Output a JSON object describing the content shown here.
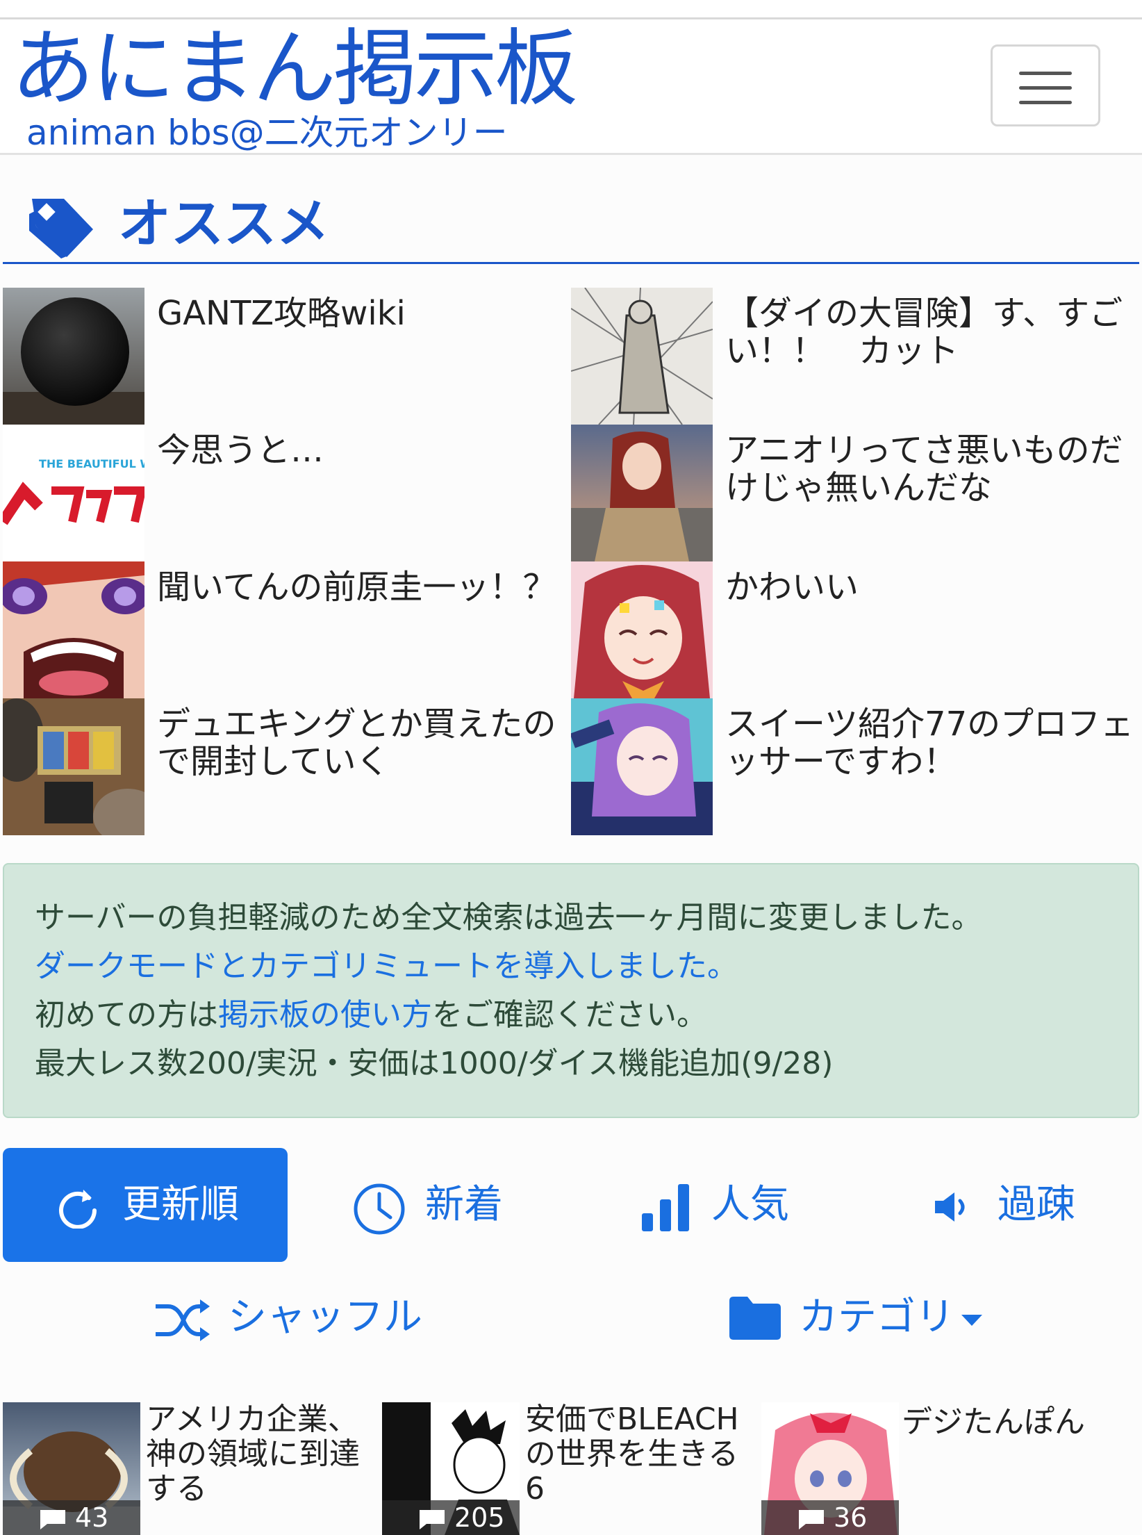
{
  "header": {
    "logo_main": "あにまん掲示板",
    "logo_sub": "animan bbs@二次元オンリー",
    "menu_icon": "hamburger-menu-icon"
  },
  "recommend": {
    "title": "オススメ",
    "icon": "tag-icon",
    "items": [
      {
        "title": "GANTZ攻略wiki"
      },
      {
        "title": "【ダイの大冒険】す、すごい！！　カット"
      },
      {
        "title": "今思うと…",
        "thumb_text": "THE BEAUTIFUL WORLD ヘタリア"
      },
      {
        "title": "アニオリってさ悪いものだけじゃ無いんだな"
      },
      {
        "title": "聞いてんの前原圭一ッ！？"
      },
      {
        "title": "かわいい"
      },
      {
        "title": "デュエキングとか買えたので開封していく"
      },
      {
        "title": "スイーツ紹介77のプロフェッサーですわ！"
      }
    ]
  },
  "notice": {
    "line1": "サーバーの負担軽減のため全文検索は過去一ヶ月間に変更しました。",
    "line2": "ダークモードとカテゴリミュートを導入しました。",
    "line3_a": "初めての方は",
    "line3_link": "掲示板の使い方",
    "line3_b": "をご確認ください。",
    "line4": "最大レス数200/実況・安価は1000/ダイス機能追加(9/28)"
  },
  "sort_tabs": [
    {
      "label": "更新順",
      "icon": "refresh-icon",
      "active": true
    },
    {
      "label": "新着",
      "icon": "clock-icon",
      "active": false
    },
    {
      "label": "人気",
      "icon": "bar-chart-icon",
      "active": false
    },
    {
      "label": "過疎",
      "icon": "speaker-icon",
      "active": false
    }
  ],
  "shuffle": {
    "label": "シャッフル",
    "icon": "shuffle-icon"
  },
  "category": {
    "label": "カテゴリ",
    "icon": "folder-icon"
  },
  "threads": [
    {
      "title": "アメリカ企業、神の領域に到達する",
      "count": "43"
    },
    {
      "title": "安価でBLEACHの世界を生きる6",
      "count": "205"
    },
    {
      "title": "デジたんぽん",
      "count": "36"
    }
  ],
  "colors": {
    "accent": "#1a56c9",
    "button": "#1a73e8",
    "notice_bg": "#d3e7dc"
  }
}
